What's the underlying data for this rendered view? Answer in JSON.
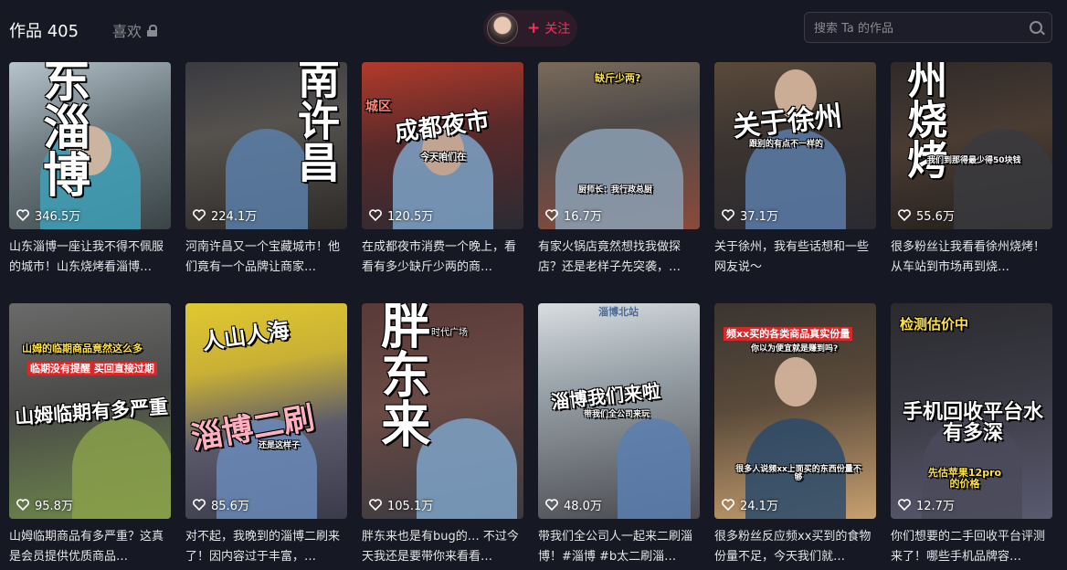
{
  "header": {
    "works_tab": "作品 405",
    "likes_tab": "喜欢",
    "follow_label": "关注",
    "search_placeholder": "搜索 Ta 的作品"
  },
  "colors": {
    "accent": "#fe2c55",
    "background": "#161823"
  },
  "videos": [
    {
      "likes": "346.5万",
      "desc": "山东淄博一座让我不得不佩服的城市！山东烧烤看淄博…",
      "overlay": "东淄博"
    },
    {
      "likes": "224.1万",
      "desc": "河南许昌又一个宝藏城市！他们竟有一个品牌让商家…",
      "overlay": "南许昌"
    },
    {
      "likes": "120.5万",
      "desc": "在成都夜市消费一个晚上，看看有多少缺斤少两的商…",
      "overlay": "成都夜市",
      "sub": "今天咱们在",
      "side": "城区"
    },
    {
      "likes": "16.7万",
      "desc": "有家火锅店竟然想找我做探店？还是老样子先突袭，…",
      "overlay": "缺斤少两?",
      "sub": "厨师长：我行政总厨"
    },
    {
      "likes": "37.1万",
      "desc": "关于徐州，我有些话想和一些网友说～",
      "overlay": "关于徐州",
      "sub": "跟别的有点不一样的"
    },
    {
      "likes": "55.6万",
      "desc": "很多粉丝让我看看徐州烧烤！从车站到市场再到烧…",
      "overlay": "州烧烤",
      "sub": "我们到那得最少得50块钱"
    },
    {
      "likes": "95.8万",
      "desc": "山姆临期商品有多严重？这真是会员提供优质商品…",
      "overlay": "山姆临期有多严重",
      "sub": "山姆的临期商品竟然这么多",
      "sub2": "临期没有提醒 买回直接过期"
    },
    {
      "likes": "85.6万",
      "desc": "对不起，我晚到的淄博二刷来了！因内容过于丰富，…",
      "overlay": "淄博二刷",
      "sub": "人山人海",
      "sub2": "还是这样子"
    },
    {
      "likes": "105.1万",
      "desc": "胖东来也是有bug的… 不过今天我还是要带你来看看…",
      "overlay": "胖东来",
      "sub": "时代广场"
    },
    {
      "likes": "48.0万",
      "desc": "带我们全公司人一起来二刷淄博！#淄博 #b太二刷淄…",
      "overlay": "淄博我们来啦",
      "sub": "带我们全公司来玩",
      "sign": "淄博北站"
    },
    {
      "likes": "24.1万",
      "desc": "很多粉丝反应频xx买到的食物份量不足，今天我们就…",
      "overlay": "频xx买的各类商品真实份量",
      "sub": "你以为便宜就是赚到吗?",
      "sub2": "很多人说频xx上面买的东西份量不够"
    },
    {
      "likes": "12.7万",
      "desc": "你们想要的二手回收平台评测来了！哪些手机品牌容…",
      "overlay": "手机回收平台水有多深",
      "sub": "检测估价中",
      "sub2": "先估苹果12pro的价格"
    }
  ]
}
